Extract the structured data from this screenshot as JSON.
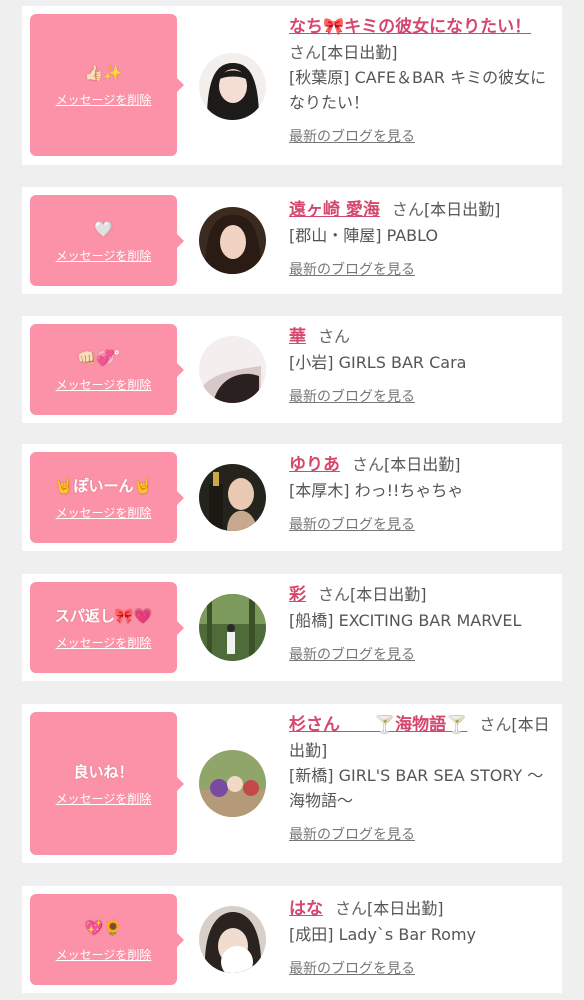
{
  "delete_label": "メッセージを削除",
  "blog_label": "最新のブログを見る",
  "honorific": "さん",
  "cards": [
    {
      "message": "👍🏻✨",
      "name": "なち🎀キミの彼女になりたい！",
      "status": "[本日出勤]",
      "shop": "[秋葉原] CAFE＆BAR キミの彼女になりたい！"
    },
    {
      "message": "🤍",
      "name": "遠ヶ崎 愛海",
      "status": "[本日出勤]",
      "shop": "[郡山・陣屋] PABLO"
    },
    {
      "message": "👊🏻💞゜",
      "name": "華",
      "status": "",
      "shop": "[小岩] GIRLS BAR Cara"
    },
    {
      "message": "🤘ぽいーん🤘",
      "name": "ゆりあ",
      "status": "[本日出勤]",
      "shop": "[本厚木] わっ!!ちゃちゃ"
    },
    {
      "message": "スパ返し🎀💗",
      "name": "彩",
      "status": "[本日出勤]",
      "shop": "[船橋] EXCITING BAR MARVEL"
    },
    {
      "message": "良いね！",
      "name": "杉さん　　🍸海物語🍸",
      "status": "[本日出勤]",
      "shop": "[新橋] GIRL'S BAR SEA STORY 〜海物語〜"
    },
    {
      "message": "💖🌻",
      "name": "はな",
      "status": "[本日出勤]",
      "shop": "[成田] Lady`s Bar Romy"
    }
  ],
  "colors": {
    "accent": "#fb92a7",
    "name": "#d6476e",
    "background": "#efefef"
  }
}
